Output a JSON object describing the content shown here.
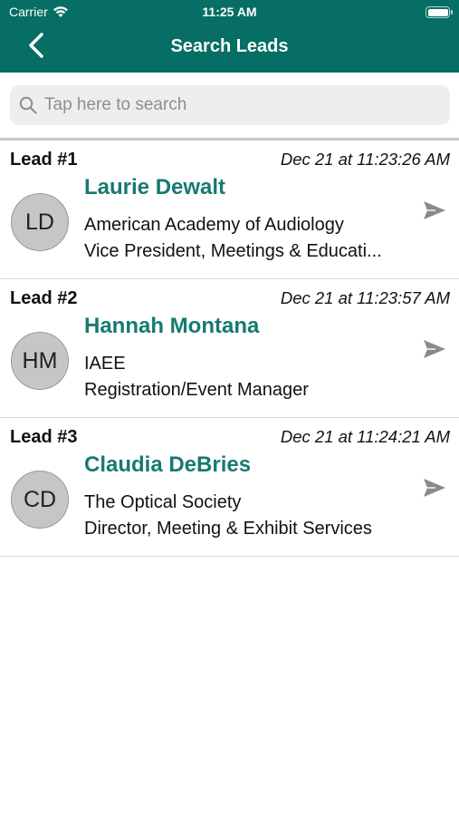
{
  "status_bar": {
    "carrier": "Carrier",
    "time": "11:25 AM"
  },
  "nav": {
    "title": "Search Leads",
    "back_icon": "chevron-left-icon"
  },
  "search": {
    "placeholder": "Tap here to search",
    "value": ""
  },
  "colors": {
    "header": "#066e64",
    "name": "#167a70",
    "avatar": "#c6c6c6"
  },
  "leads": [
    {
      "number": "Lead #1",
      "timestamp": "Dec 21 at 11:23:26 AM",
      "initials": "LD",
      "name": "Laurie Dewalt",
      "organization": "American Academy of Audiology",
      "title": "Vice President, Meetings & Educati..."
    },
    {
      "number": "Lead #2",
      "timestamp": "Dec 21 at 11:23:57 AM",
      "initials": "HM",
      "name": "Hannah Montana",
      "organization": "IAEE",
      "title": "Registration/Event Manager"
    },
    {
      "number": "Lead #3",
      "timestamp": "Dec 21 at 11:24:21 AM",
      "initials": "CD",
      "name": "Claudia DeBries",
      "organization": "The Optical Society",
      "title": "Director, Meeting & Exhibit Services"
    }
  ]
}
